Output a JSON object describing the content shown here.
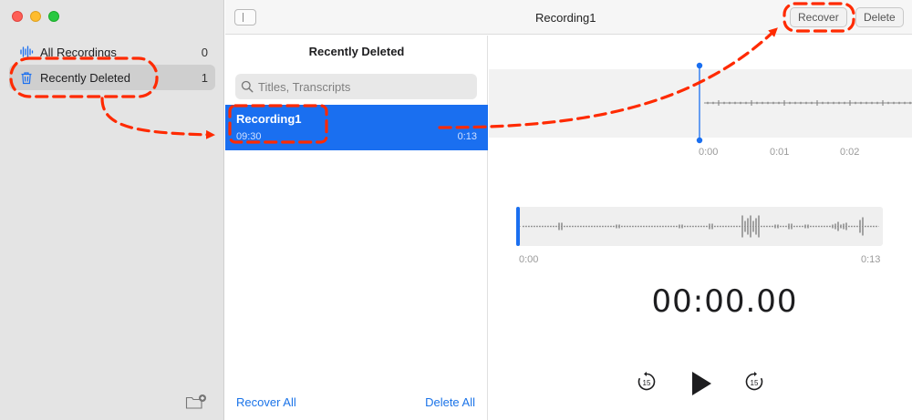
{
  "window": {
    "title": "Recording1",
    "toolbar": {
      "recover_label": "Recover",
      "delete_label": "Delete"
    }
  },
  "sidebar": {
    "items": [
      {
        "label": "All Recordings",
        "count": "0",
        "icon": "waveform-icon"
      },
      {
        "label": "Recently Deleted",
        "count": "1",
        "icon": "trash-icon",
        "selected": true
      }
    ]
  },
  "list": {
    "heading": "Recently Deleted",
    "search_placeholder": "Titles, Transcripts",
    "recordings": [
      {
        "name": "Recording1",
        "time": "09:30",
        "duration": "0:13",
        "selected": true
      }
    ],
    "recover_all_label": "Recover All",
    "delete_all_label": "Delete All"
  },
  "detail": {
    "timeline_ticks": [
      "0:00",
      "0:01",
      "0:02"
    ],
    "scrubber_start": "0:00",
    "scrubber_end": "0:13",
    "timer": "00:00.00",
    "skip_back_seconds": "15",
    "skip_forward_seconds": "15"
  },
  "colors": {
    "accent": "#1a6ff0",
    "annotation": "#ff2a00"
  }
}
